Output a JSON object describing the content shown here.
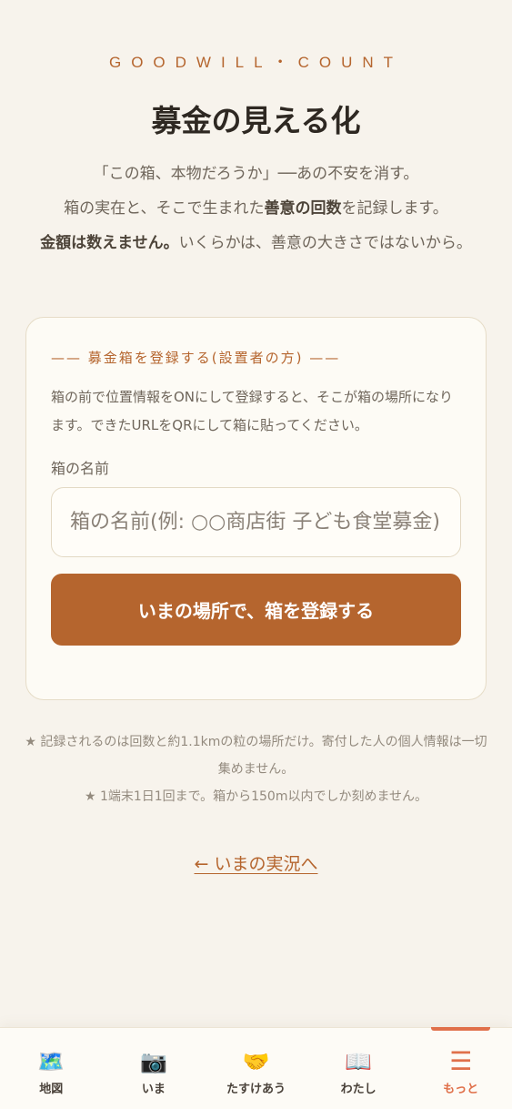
{
  "header": {
    "eyebrow": "GOODWILL・COUNT",
    "title": "募金の見える化"
  },
  "intro": {
    "line1": "「この箱、本物だろうか」──あの不安を消す。",
    "line2_pre": "箱の実在と、そこで生まれた",
    "line2_bold": "善意の回数",
    "line2_post": "を記録します。",
    "line3_bold": "金額は数えません。",
    "line3_post": "いくらかは、善意の大きさではないから。"
  },
  "register_card": {
    "heading": "—— 募金箱を登録する(設置者の方) ——",
    "description": "箱の前で位置情報をONにして登録すると、そこが箱の場所になります。できたURLをQRにして箱に貼ってください。",
    "name_label": "箱の名前",
    "name_placeholder": "箱の名前(例: ○○商店街 子ども食堂募金)",
    "name_value": "",
    "submit_label": "いまの場所で、箱を登録する"
  },
  "notes": {
    "line1": "★ 記録されるのは回数と約1.1kmの粒の場所だけ。寄付した人の個人情報は一切集めません。",
    "line2": "★ 1端末1日1回まで。箱から150m以内でしか刻めません。"
  },
  "back_link": "← いまの実況へ",
  "tabbar": {
    "active": "more",
    "items": [
      {
        "id": "map",
        "icon": "🗺️",
        "label": "地図"
      },
      {
        "id": "now",
        "icon": "📷",
        "label": "いま"
      },
      {
        "id": "help",
        "icon": "🤝",
        "label": "たすけあう"
      },
      {
        "id": "me",
        "icon": "📖",
        "label": "わたし"
      },
      {
        "id": "more",
        "icon": "☰",
        "label": "もっと"
      }
    ]
  },
  "colors": {
    "accent": "#b5652e",
    "active_tab": "#e0704a",
    "background": "#f7f3ec"
  }
}
